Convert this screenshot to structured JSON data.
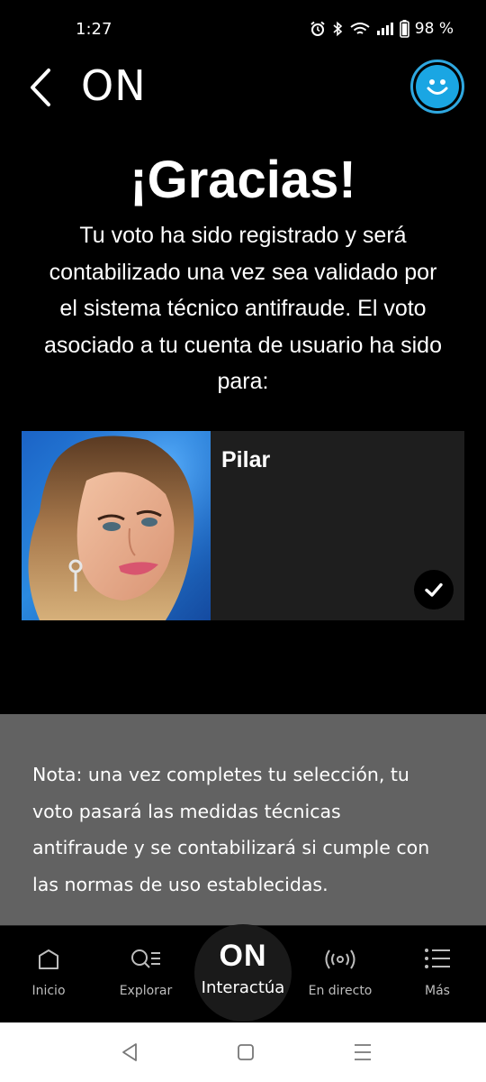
{
  "status_bar": {
    "time": "1:27",
    "battery": "98 %"
  },
  "header": {
    "title": "ON",
    "back_icon": "chevron-left-icon",
    "avatar_icon": "smiley-avatar-icon",
    "accent_color": "#1aa6e3"
  },
  "confirmation": {
    "title": "¡Gracias!",
    "message_lines": [
      "Tu voto ha sido registrado y será",
      "contabilizado una vez sea validado por",
      "el sistema técnico antifraude. El voto",
      "asociado a tu cuenta de usuario ha sido",
      "para:"
    ]
  },
  "candidate": {
    "name": "Pilar",
    "selected": true
  },
  "note": {
    "lines": [
      "Nota: una vez completes tu selección, tu",
      "voto pasará las medidas técnicas",
      "antifraude y se contabilizará si cumple con",
      "las normas de uso establecidas."
    ]
  },
  "bottom_nav": {
    "items": [
      {
        "label": "Inicio",
        "icon": "home-icon"
      },
      {
        "label": "Explorar",
        "icon": "search-list-icon"
      },
      {
        "label": "Interactúa",
        "icon": "on-logo-icon",
        "logo_text": "ON"
      },
      {
        "label": "En directo",
        "icon": "broadcast-icon"
      },
      {
        "label": "Más",
        "icon": "menu-list-icon"
      }
    ]
  }
}
